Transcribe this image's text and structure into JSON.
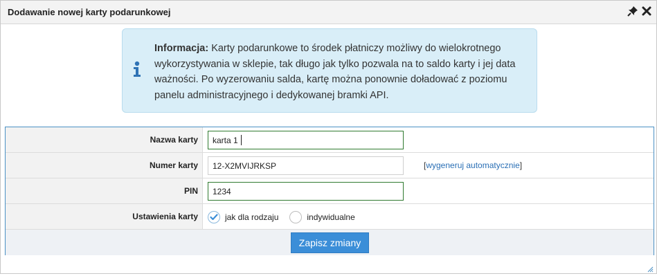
{
  "dialog": {
    "title": "Dodawanie nowej karty podarunkowej",
    "pin_icon": "pin-icon",
    "close_icon": "close-icon"
  },
  "info": {
    "icon": "info-icon",
    "heading": "Informacja:",
    "text": " Karty podarunkowe to środek płatniczy możliwy do wielokrotnego wykorzystywania w sklepie, tak długo jak tylko pozwala na to saldo karty i jej data ważności. Po wyzerowaniu salda, kartę można ponownie doładować z poziomu panelu administracyjnego i dedykowanej bramki API.",
    "background": "#d9eef8"
  },
  "form": {
    "card_name": {
      "label": "Nazwa karty",
      "value": "karta 1"
    },
    "card_number": {
      "label": "Numer karty",
      "value": "12-X2MVIJRKSP",
      "generate_prefix": "[",
      "generate_link": "wygeneruj automatycznie",
      "generate_suffix": "]"
    },
    "pin": {
      "label": "PIN",
      "value": "1234"
    },
    "settings": {
      "label": "Ustawienia karty",
      "option_1": "jak dla rodzaju",
      "option_2": "indywidualne",
      "selected": "jak dla rodzaju"
    },
    "save_label": "Zapisz zmiany",
    "accent_color": "#3b8ed8"
  }
}
